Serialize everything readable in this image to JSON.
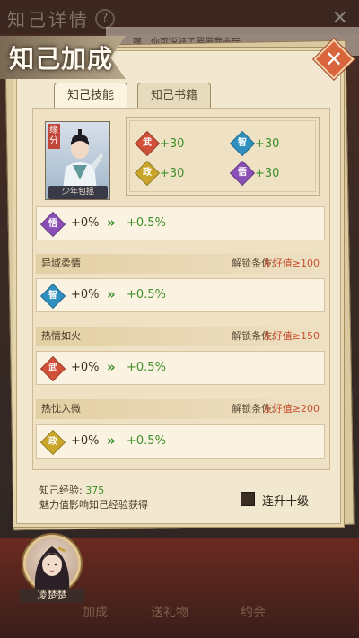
{
  "background": {
    "title": "知己详情",
    "help_glyph": "?",
    "close_glyph": "✕",
    "chat_text": "嘿，你可说好了要带我去玩",
    "bottom_tabs": [
      "加成",
      "送礼物",
      "约会"
    ]
  },
  "panel": {
    "title": "知己加成",
    "close_glyph": "✕",
    "tabs": [
      {
        "label": "知己技能",
        "active": true
      },
      {
        "label": "知己书籍",
        "active": false
      }
    ]
  },
  "portrait": {
    "badge": "缘分",
    "name": "少年包拯"
  },
  "stats": [
    {
      "attr": "武",
      "color": "#d0503a",
      "value": "+30"
    },
    {
      "attr": "智",
      "color": "#2f8fbf",
      "value": "+30"
    },
    {
      "attr": "政",
      "color": "#c9a52a",
      "value": "+30"
    },
    {
      "attr": "悟",
      "color": "#8a4fb5",
      "value": "+30"
    }
  ],
  "skills": [
    {
      "name": "",
      "attr": "悟",
      "color": "#8a4fb5",
      "current": "+0%",
      "arrow": "»",
      "next": "+0.5%"
    },
    {
      "name": "异域柔情",
      "condition_label": "解锁条件:",
      "requirement": "友好值≥100",
      "attr": "智",
      "color": "#2f8fbf",
      "current": "+0%",
      "arrow": "»",
      "next": "+0.5%"
    },
    {
      "name": "热情如火",
      "condition_label": "解锁条件:",
      "requirement": "友好值≥150",
      "attr": "武",
      "color": "#d0503a",
      "current": "+0%",
      "arrow": "»",
      "next": "+0.5%"
    },
    {
      "name": "热忱入微",
      "condition_label": "解锁条件:",
      "requirement": "友好值≥200",
      "attr": "政",
      "color": "#c9a52a",
      "current": "+0%",
      "arrow": "»",
      "next": "+0.5%"
    }
  ],
  "footer": {
    "exp_label": "知己经验:",
    "exp_value": "375",
    "exp_hint": "魅力值影响知己经验获得",
    "level_up_label": "连升十级",
    "level_up_checked": false
  },
  "character": {
    "name": "凌楚楚"
  }
}
